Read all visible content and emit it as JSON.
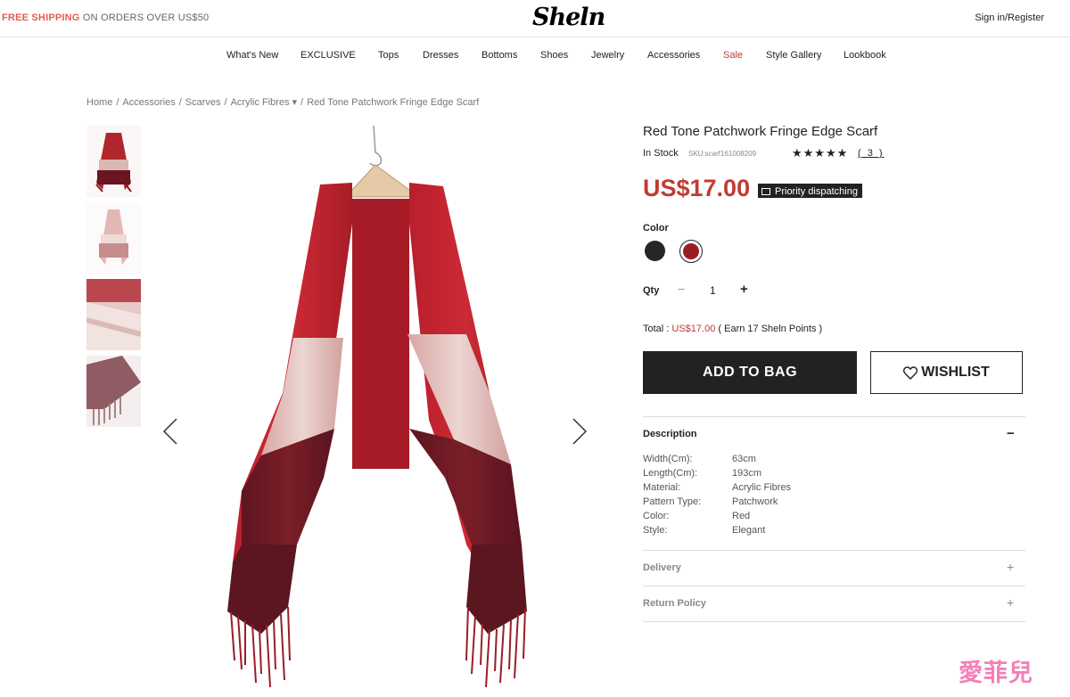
{
  "topbar": {
    "promo_highlight": "FREE SHIPPING",
    "promo_rest": " ON ORDERS OVER US$50",
    "logo": "Sheln",
    "signin": "Sign in/Register"
  },
  "nav": {
    "items": [
      "What's New",
      "EXCLUSIVE",
      "Tops",
      "Dresses",
      "Bottoms",
      "Shoes",
      "Jewelry",
      "Accessories",
      "Sale",
      "Style Gallery",
      "Lookbook"
    ]
  },
  "breadcrumb": {
    "items": [
      "Home",
      "Accessories",
      "Scarves",
      "Acrylic Fibres ▾",
      "Red Tone Patchwork Fringe Edge Scarf"
    ],
    "separator": "/"
  },
  "product": {
    "title": "Red Tone Patchwork Fringe Edge Scarf",
    "stock": "In Stock",
    "sku": "SKU:scarf161008209",
    "stars": "★★★★★",
    "rating": 5,
    "reviews": "( 3 )",
    "price": "US$17.00",
    "priority": "Priority dispatching",
    "color_label": "Color",
    "colors": [
      {
        "name": "black",
        "hex": "#262626"
      },
      {
        "name": "red",
        "hex": "#9a1d24"
      }
    ],
    "qty_label": "Qty",
    "qty_minus": "−",
    "qty": "1",
    "qty_plus": "+",
    "total_prefix": "Total : ",
    "total_price": "US$17.00",
    "total_suffix": " ( Earn 17 Sheln Points )",
    "add_to_bag": "ADD TO BAG",
    "wishlist": "WISHLIST"
  },
  "description": {
    "title": "Description",
    "toggle": "−",
    "specs": [
      {
        "k": "Width(Cm):",
        "v": "63cm"
      },
      {
        "k": "Length(Cm):",
        "v": "193cm"
      },
      {
        "k": "Material:",
        "v": "Acrylic Fibres"
      },
      {
        "k": "Pattern Type:",
        "v": "Patchwork"
      },
      {
        "k": "Color:",
        "v": "Red"
      },
      {
        "k": "Style:",
        "v": "Elegant"
      }
    ]
  },
  "accordion": {
    "delivery": "Delivery",
    "return_policy": "Return Policy",
    "toggle": "+"
  },
  "watermark": "愛菲兒",
  "colors": {
    "accent": "#c13b34",
    "promo": "#e75b50",
    "button": "#222222"
  }
}
